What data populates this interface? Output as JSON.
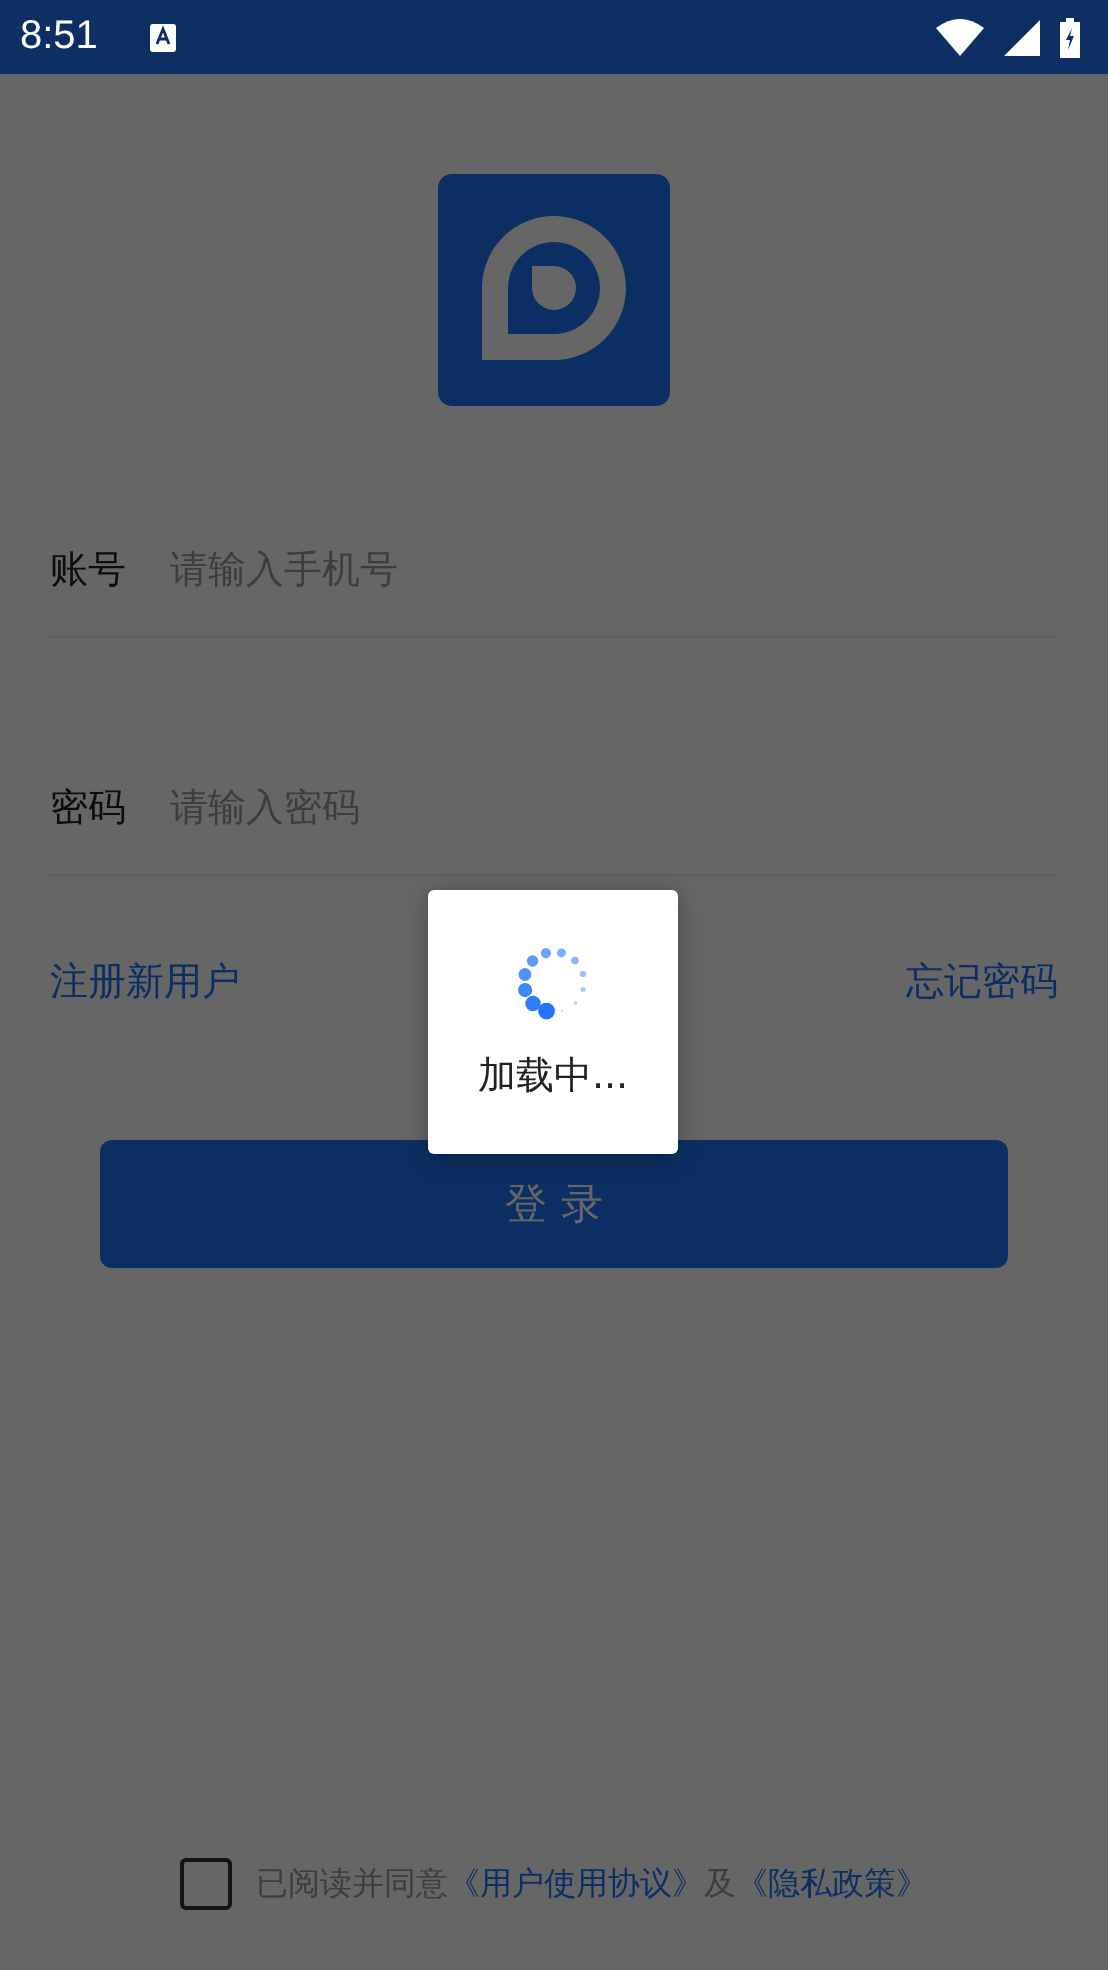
{
  "status_bar": {
    "time": "8:51"
  },
  "account": {
    "label": "账号",
    "placeholder": "请输入手机号"
  },
  "password": {
    "label": "密码",
    "placeholder": "请输入密码"
  },
  "register_link": "注册新用户",
  "forgot_link": "忘记密码",
  "login_button": "登 录",
  "agreement": {
    "checked": false,
    "text": "已阅读并同意",
    "link_terms": "《用户使用协议》",
    "conjunction": "及",
    "link_privacy": "《隐私政策》"
  },
  "loading_dialog": {
    "text": "加载中..."
  }
}
